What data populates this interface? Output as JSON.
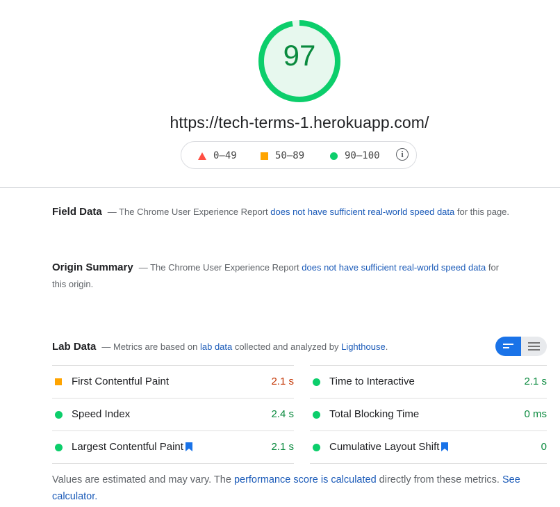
{
  "score": {
    "value": "97",
    "fraction": 0.97
  },
  "url": "https://tech-terms-1.herokuapp.com/",
  "legend": {
    "fail": "0–49",
    "average": "50–89",
    "pass": "90–100"
  },
  "field_data": {
    "title": "Field Data",
    "prefix": "— The Chrome User Experience Report ",
    "link": "does not have sufficient real-world speed data",
    "suffix": " for this page."
  },
  "origin_summary": {
    "title": "Origin Summary",
    "prefix": "— The Chrome User Experience Report ",
    "link": "does not have sufficient real-world speed data",
    "suffix": " for this origin."
  },
  "lab_data": {
    "title": "Lab Data",
    "prefix": "— Metrics are based on ",
    "link1": "lab data",
    "middle": " collected and analyzed by ",
    "link2": "Lighthouse",
    "suffix": "."
  },
  "metrics": {
    "left": [
      {
        "name": "First Contentful Paint",
        "value": "2.1 s",
        "rating": "average"
      },
      {
        "name": "Speed Index",
        "value": "2.4 s",
        "rating": "pass"
      },
      {
        "name": "Largest Contentful Paint",
        "value": "2.1 s",
        "rating": "pass"
      }
    ],
    "right": [
      {
        "name": "Time to Interactive",
        "value": "2.1 s",
        "rating": "pass"
      },
      {
        "name": "Total Blocking Time",
        "value": "0 ms",
        "rating": "pass"
      },
      {
        "name": "Cumulative Layout Shift",
        "value": "0",
        "rating": "pass"
      }
    ]
  },
  "footer": {
    "prefix": "Values are estimated and may vary. The ",
    "link1": "performance score is calculated",
    "middle": " directly from these metrics. ",
    "link2": "See calculator.",
    "suffix": ""
  },
  "colors": {
    "pass": "#0cce6b",
    "average": "#ffa400",
    "fail": "#ff4e42",
    "link": "#1a5ab8",
    "toggle_active": "#1a73e8"
  }
}
